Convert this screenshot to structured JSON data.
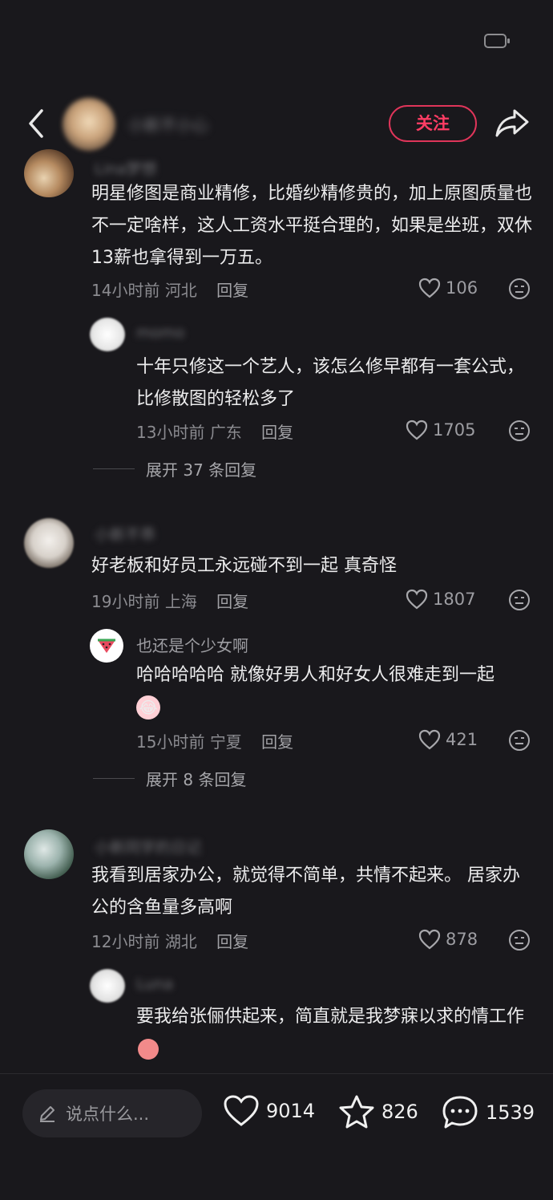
{
  "header": {
    "follow_label": "关注",
    "author_name": "小新不小心",
    "icons": [
      "back-icon",
      "share-icon"
    ]
  },
  "comments": [
    {
      "name": "Lina梦想",
      "text": "明星修图是商业精修，比婚纱精修贵的，加上原图质量也不一定啥样，这人工资水平挺合理的，如果是坐班，双休13薪也拿得到一万五。",
      "time": "14小时前",
      "location": "河北",
      "reply_label": "回复",
      "likes": "106",
      "replies": [
        {
          "name": "momo",
          "text": "十年只修这一个艺人，该怎么修早都有一套公式，比修散图的轻松多了",
          "time": "13小时前",
          "location": "广东",
          "reply_label": "回复",
          "likes": "1705"
        }
      ],
      "expand_label": "展开 37 条回复"
    },
    {
      "name": "小新不乖",
      "text": "好老板和好员工永远碰不到一起 真奇怪",
      "time": "19小时前",
      "location": "上海",
      "reply_label": "回复",
      "likes": "1807",
      "replies": [
        {
          "name": "也还是个少女啊",
          "text": "哈哈哈哈哈 就像好男人和好女人很难走到一起",
          "time": "15小时前",
          "location": "宁夏",
          "reply_label": "回复",
          "likes": "421"
        }
      ],
      "expand_label": "展开 8 条回复"
    },
    {
      "name": "小新同学的日记",
      "text": "我看到居家办公，就觉得不简单，共情不起来。 居家办公的含鱼量多高啊",
      "time": "12小时前",
      "location": "湖北",
      "reply_label": "回复",
      "likes": "878",
      "replies": [
        {
          "name": "Luna",
          "text": "要我给张俪供起来，简直就是我梦寐以求的情工作"
        }
      ]
    }
  ],
  "bottom_bar": {
    "input_placeholder": "说点什么...",
    "likes": "9014",
    "favorites": "826",
    "comments": "1539"
  },
  "colors": {
    "background": "#19181c",
    "accent": "#ff3d64"
  }
}
